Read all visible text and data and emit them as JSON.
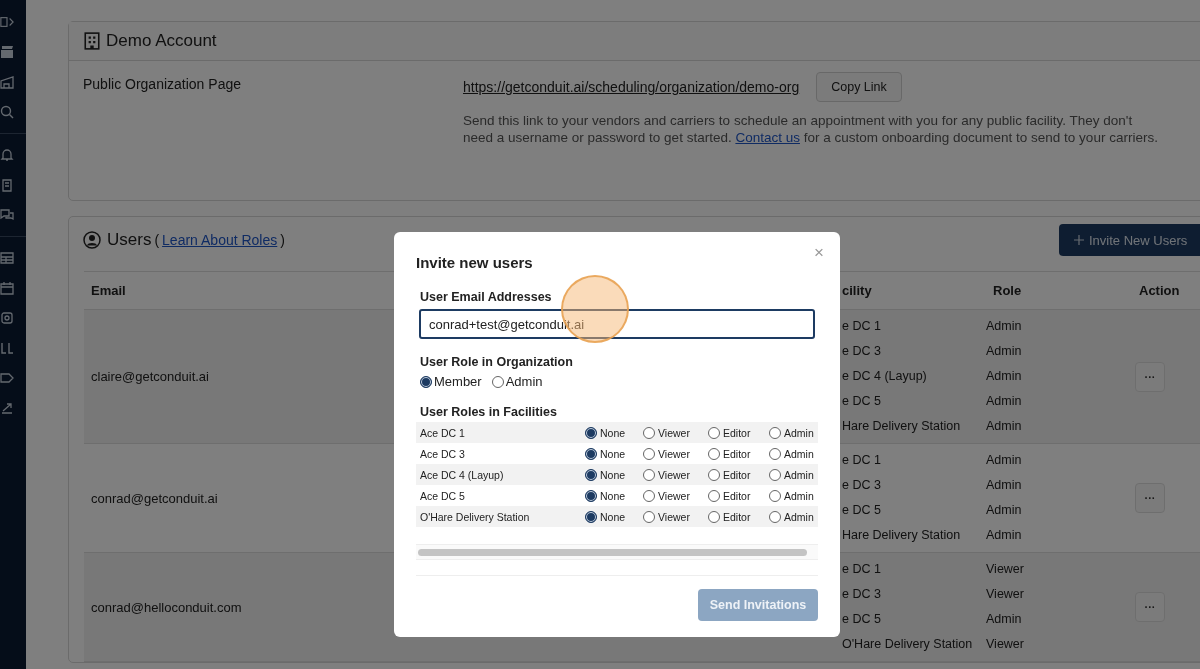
{
  "account": {
    "title": "Demo Account",
    "field_label": "Public Organization Page",
    "url": "https://getconduit.ai/scheduling/organization/demo-org",
    "copy_button": "Copy Link",
    "description": {
      "before": "Send this link to your vendors and carriers to schedule an appointment with you for any public facility. They don't need a username or password to get started. ",
      "link": "Contact us",
      "after": " for a custom onboarding document to send to your carriers."
    }
  },
  "users": {
    "title": "Users",
    "link_prefix": "(",
    "link": "Learn About Roles",
    "link_suffix": ")",
    "invite_button": "Invite New Users",
    "columns": {
      "email": "Email",
      "facility": "cility",
      "role": "Role",
      "action": "Action"
    },
    "rows": [
      {
        "email": "claire@getconduit.ai",
        "action": "···",
        "access": [
          {
            "facility": "e DC 1",
            "role": "Admin"
          },
          {
            "facility": "e DC 3",
            "role": "Admin"
          },
          {
            "facility": "e DC 4 (Layup)",
            "role": "Admin"
          },
          {
            "facility": "e DC 5",
            "role": "Admin"
          },
          {
            "facility": "Hare Delivery Station",
            "role": "Admin"
          }
        ]
      },
      {
        "email": "conrad@getconduit.ai",
        "action": "···",
        "access": [
          {
            "facility": "e DC 1",
            "role": "Admin"
          },
          {
            "facility": "e DC 3",
            "role": "Admin"
          },
          {
            "facility": "e DC 5",
            "role": "Admin"
          },
          {
            "facility": "Hare Delivery Station",
            "role": "Admin"
          }
        ]
      },
      {
        "email": "conrad@helloconduit.com",
        "action": "···",
        "access": [
          {
            "facility": "e DC 1",
            "role": "Viewer"
          },
          {
            "facility": "e DC 3",
            "role": "Viewer"
          },
          {
            "facility": "e DC 5",
            "role": "Admin"
          },
          {
            "facility": "O'Hare Delivery Station",
            "role": "Viewer"
          }
        ]
      }
    ]
  },
  "modal": {
    "title": "Invite new users",
    "close": "×",
    "email_label": "User Email Addresses",
    "email_value": "conrad+test@getconduit.ai",
    "org_role_label": "User Role in Organization",
    "org_roles": [
      {
        "label": "Member",
        "selected": true
      },
      {
        "label": "Admin",
        "selected": false
      }
    ],
    "facility_roles_label": "User Roles in Facilities",
    "facility_roles": [
      {
        "facility": "Ace DC 1",
        "options": [
          {
            "label": "None",
            "selected": true
          },
          {
            "label": "Viewer",
            "selected": false
          },
          {
            "label": "Editor",
            "selected": false
          },
          {
            "label": "Admin",
            "selected": false
          }
        ]
      },
      {
        "facility": "Ace DC 3",
        "options": [
          {
            "label": "None",
            "selected": true
          },
          {
            "label": "Viewer",
            "selected": false
          },
          {
            "label": "Editor",
            "selected": false
          },
          {
            "label": "Admin",
            "selected": false
          }
        ]
      },
      {
        "facility": "Ace DC 4 (Layup)",
        "options": [
          {
            "label": "None",
            "selected": true
          },
          {
            "label": "Viewer",
            "selected": false
          },
          {
            "label": "Editor",
            "selected": false
          },
          {
            "label": "Admin",
            "selected": false
          }
        ]
      },
      {
        "facility": "Ace DC 5",
        "options": [
          {
            "label": "None",
            "selected": true
          },
          {
            "label": "Viewer",
            "selected": false
          },
          {
            "label": "Editor",
            "selected": false
          },
          {
            "label": "Admin",
            "selected": false
          }
        ]
      },
      {
        "facility": "O'Hare Delivery Station",
        "options": [
          {
            "label": "None",
            "selected": true
          },
          {
            "label": "Viewer",
            "selected": false
          },
          {
            "label": "Editor",
            "selected": false
          },
          {
            "label": "Admin",
            "selected": false
          }
        ]
      }
    ],
    "send_button": {
      "label": "Send Invitations",
      "disabled": true
    }
  }
}
